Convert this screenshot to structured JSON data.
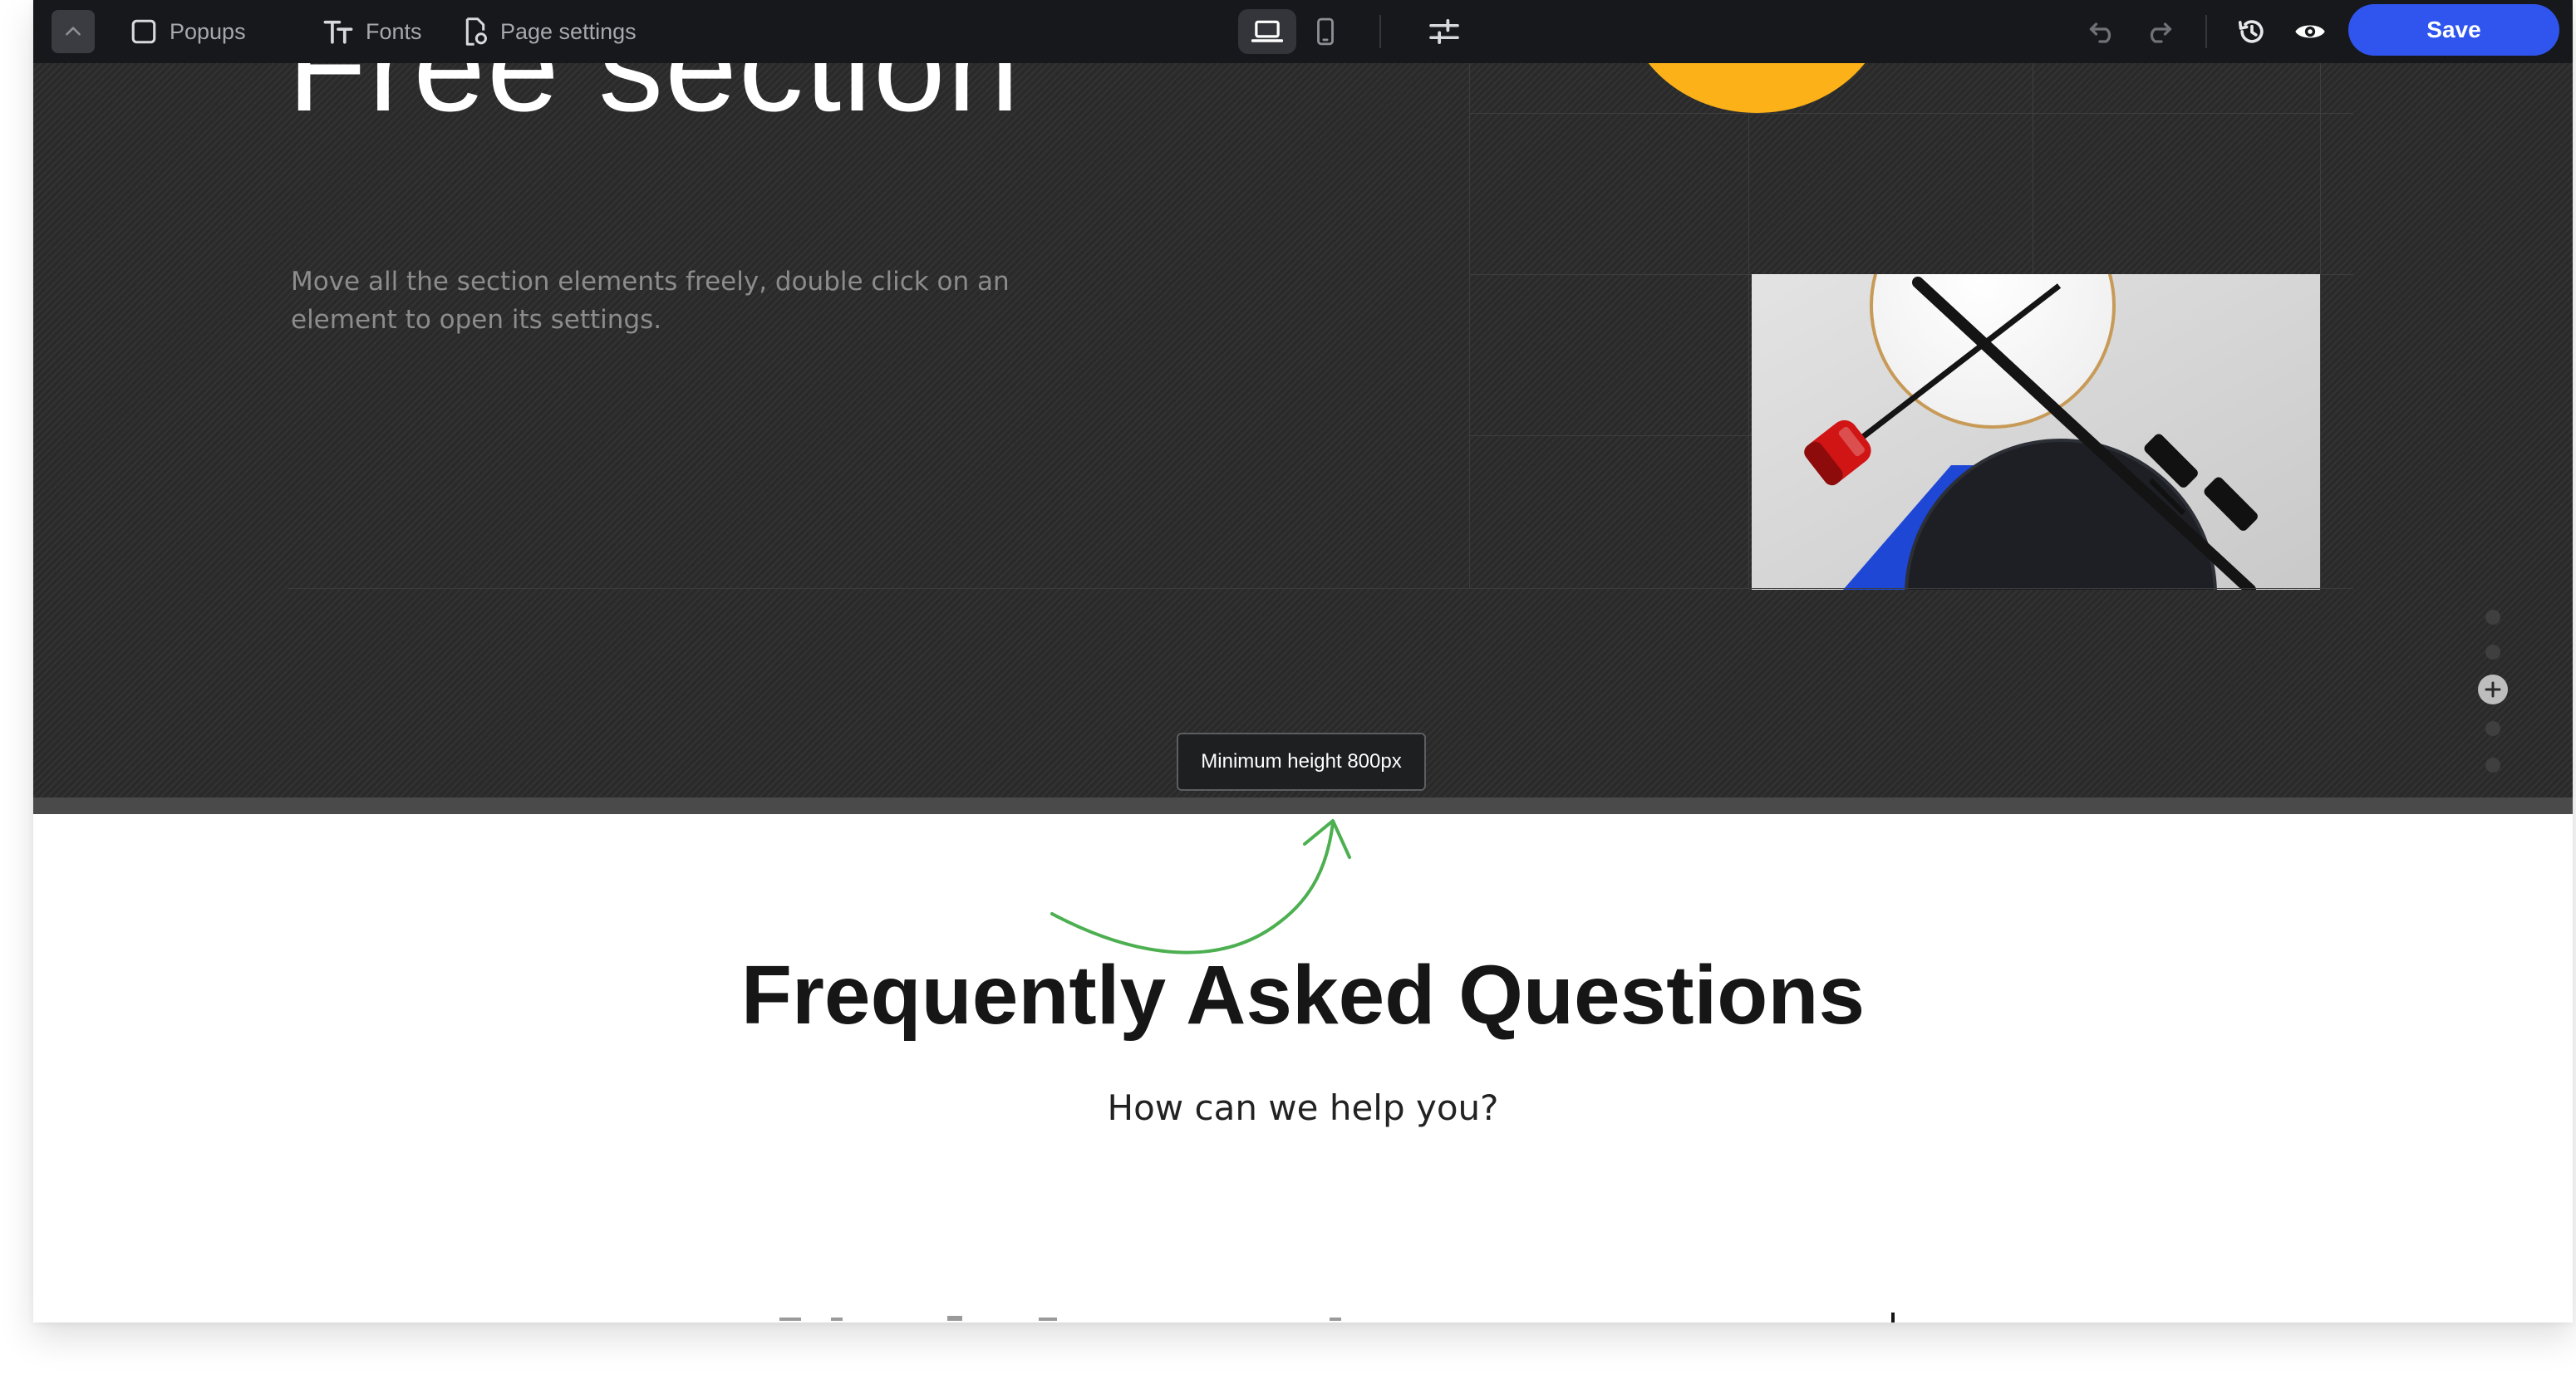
{
  "toolbar": {
    "popups_label": "Popups",
    "fonts_label": "Fonts",
    "page_settings_label": "Page settings",
    "save_label": "Save",
    "icons": {
      "collapse": "chevron-up-icon",
      "popups": "square-icon",
      "fonts": "text-size-icon",
      "page_settings": "page-gear-icon",
      "desktop": "laptop-icon",
      "mobile": "phone-icon",
      "adjust": "sliders-icon",
      "undo": "undo-icon",
      "redo": "redo-icon",
      "history": "history-icon",
      "preview": "eye-icon"
    },
    "active_device": "desktop"
  },
  "hero": {
    "title": "Free section",
    "description": "Move all the section elements freely, double click on an element to open its settings.",
    "resize_tooltip": "Minimum height 800px"
  },
  "faq": {
    "title": "Frequently Asked Questions",
    "subtitle": "How can we help you?"
  },
  "colors": {
    "toolbar_bg": "#17181b",
    "save_button": "#2f55ee",
    "hero_bg": "#2a2a2a",
    "accent_yellow": "#fbb117",
    "arrow_green": "#4caf50",
    "lamp_red": "#d11414",
    "blue_shape": "#1f47d6"
  }
}
